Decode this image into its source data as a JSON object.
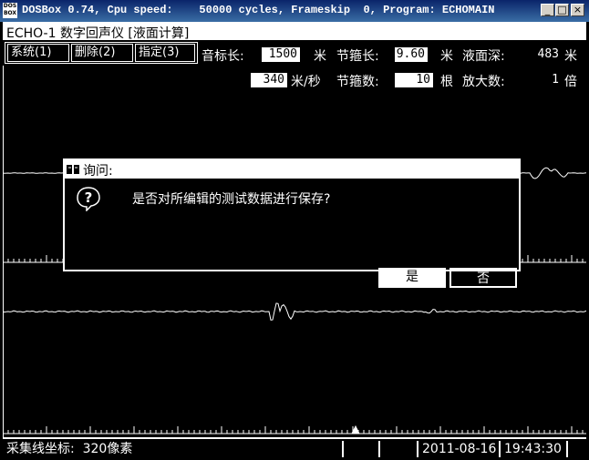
{
  "window": {
    "icon_label": "DOS BOX",
    "title": "DOSBox 0.74, Cpu speed:    50000 cycles, Frameskip  0, Program: ECHOMAIN",
    "minimize": "_",
    "maximize": "□",
    "close": "×"
  },
  "app": {
    "title": "ECHO-1 数字回声仪 [液面计算]"
  },
  "menu": [
    {
      "label": "系统(1)"
    },
    {
      "label": "删除(2)"
    },
    {
      "label": "指定(3)"
    }
  ],
  "params": {
    "sound_mark_label": "音标长:",
    "sound_mark_value": "1500",
    "sound_mark_unit": "米",
    "joint_length_label": "节箍长:",
    "joint_length_value": "9.60",
    "joint_length_unit": "米",
    "depth_label": "液面深:",
    "depth_value": "483",
    "depth_unit": "米",
    "speed_value": "340",
    "speed_unit": "米/秒",
    "joint_count_label": "节箍数:",
    "joint_count_value": "10",
    "joint_count_unit": "根",
    "zoom_label": "放大数:",
    "zoom_value": "1",
    "zoom_unit": "倍"
  },
  "dialog": {
    "title": "询问:",
    "icon": "question-icon",
    "message": "是否对所编辑的测试数据进行保存?",
    "yes_label": "是",
    "no_label": "否"
  },
  "status": {
    "cursor_label": "采集线坐标:  320像素",
    "date": "2011-08-16",
    "time": "19:43:30"
  }
}
